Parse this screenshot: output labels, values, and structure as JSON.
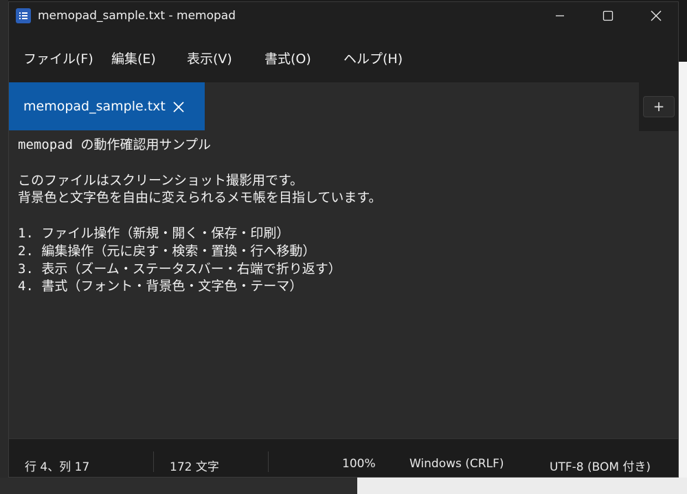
{
  "window": {
    "title": "memopad_sample.txt - memopad"
  },
  "menu": {
    "items": [
      {
        "label": "ファイル(F)"
      },
      {
        "label": "編集(E)"
      },
      {
        "label": "表示(V)"
      },
      {
        "label": "書式(O)"
      },
      {
        "label": "ヘルプ(H)"
      }
    ]
  },
  "tabs": {
    "active_label": "memopad_sample.txt",
    "add_label": "+"
  },
  "editor": {
    "lines": [
      "memopad の動作確認用サンプル",
      "",
      "このファイルはスクリーンショット撮影用です。",
      "背景色と文字色を自由に変えられるメモ帳を目指しています。",
      "",
      "1. ファイル操作（新規・開く・保存・印刷）",
      "2. 編集操作（元に戻す・検索・置換・行へ移動）",
      "3. 表示（ズーム・ステータスバー・右端で折り返す）",
      "4. 書式（フォント・背景色・文字色・テーマ）"
    ]
  },
  "status": {
    "position": "行 4、列 17",
    "char_count": "172 文字",
    "zoom": "100%",
    "line_ending": "Windows (CRLF)",
    "encoding": "UTF-8 (BOM 付き)"
  },
  "colors": {
    "tab_active": "#0e5aa7",
    "editor_bg": "#2b2b2b",
    "editor_text": "#f2f2f2",
    "app_icon": "#2b5fb8"
  },
  "icons": {
    "app": "notepad-icon",
    "minimize": "minimize-icon",
    "maximize": "maximize-icon",
    "close": "close-icon",
    "tab_close": "close-icon",
    "add_tab": "plus-icon"
  }
}
